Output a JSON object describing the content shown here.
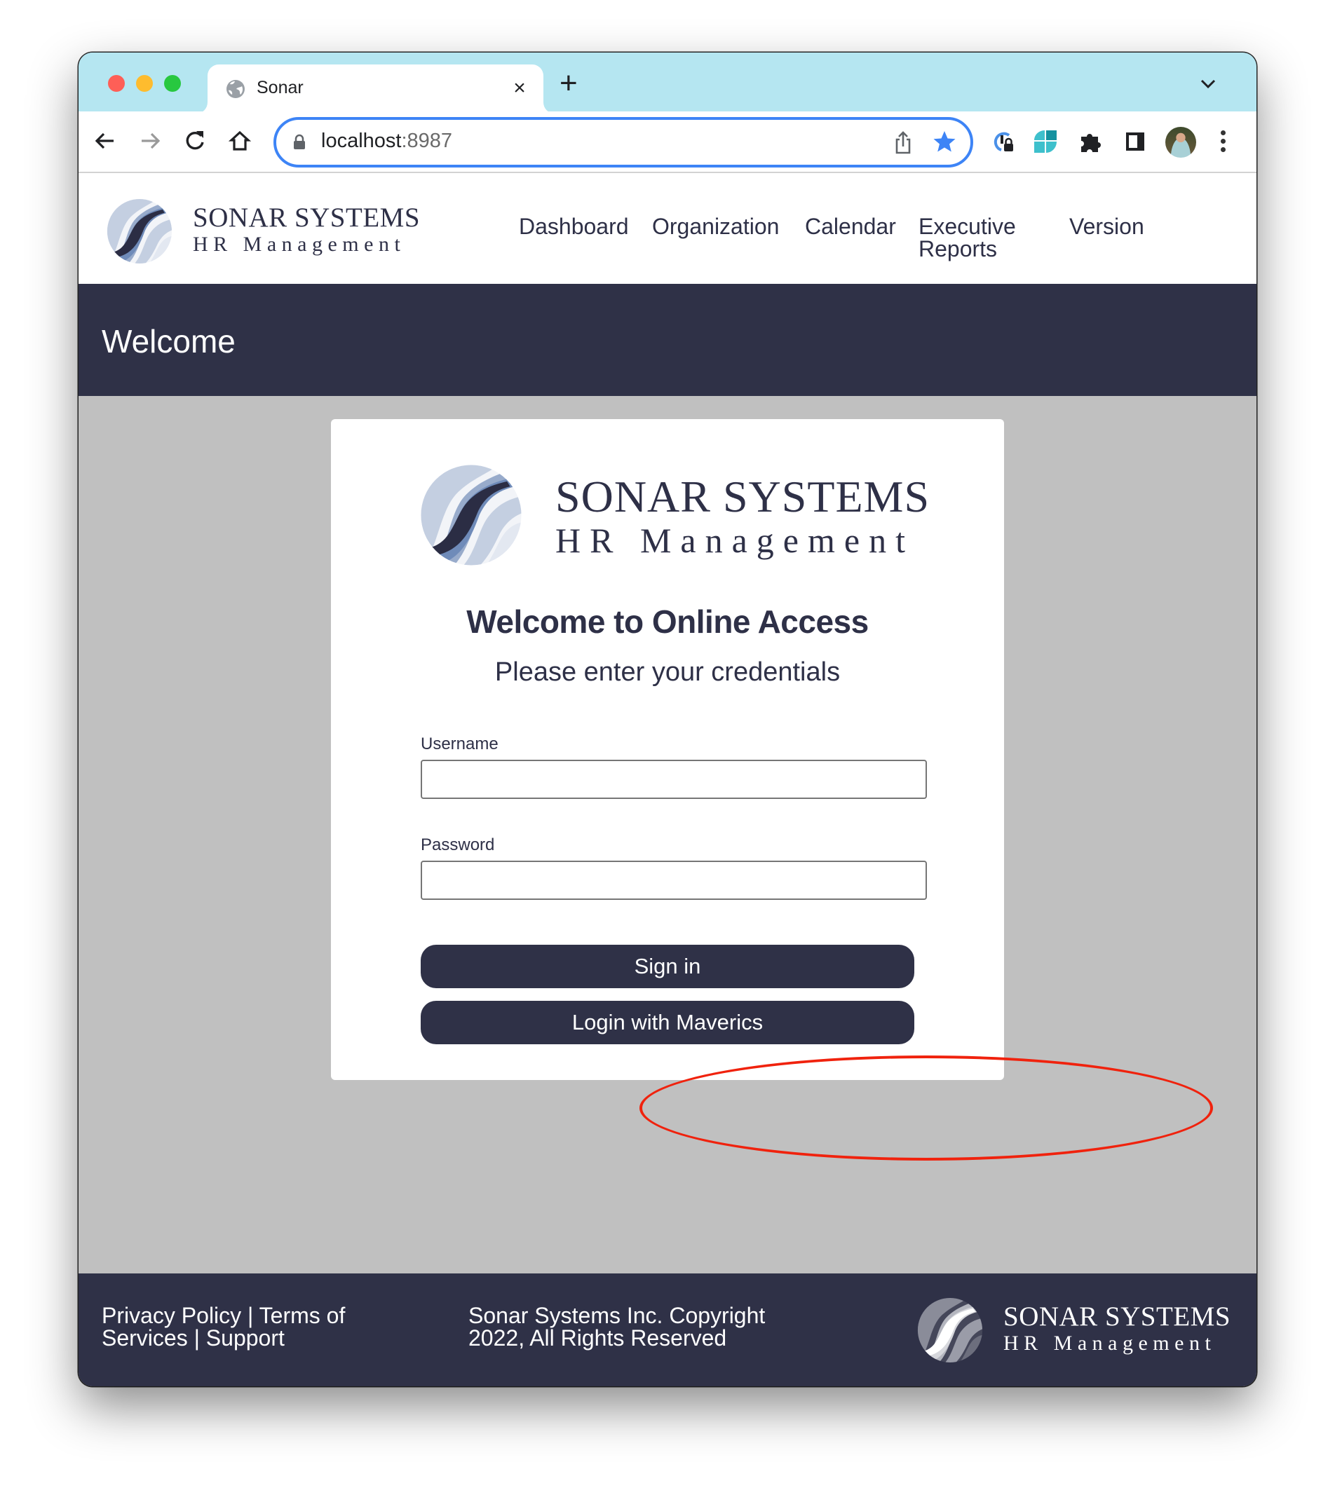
{
  "browser": {
    "tab": {
      "title": "Sonar",
      "favicon": "globe-icon",
      "close_glyph": "×"
    },
    "new_tab_glyph": "+",
    "address": {
      "host": "localhost",
      "port": ":8987"
    },
    "toolbar_icons": [
      "back-arrow-icon",
      "forward-arrow-icon",
      "reload-icon",
      "home-icon",
      "lock-icon",
      "share-icon",
      "bookmark-star-icon",
      "extension-password-icon",
      "extension-tiles-icon",
      "extensions-puzzle-icon",
      "side-panel-icon",
      "profile-avatar",
      "menu-dots-icon"
    ],
    "colors": {
      "tabstrip": "#b5e6f1",
      "omnibox_border": "#3d84f6",
      "star": "#3d84f6"
    }
  },
  "header": {
    "brand_line1": "SONAR SYSTEMS",
    "brand_line2": "HR Management",
    "nav": [
      {
        "label": "Dashboard"
      },
      {
        "label": "Organization"
      },
      {
        "label": "Calendar"
      },
      {
        "label": "Executive Reports"
      },
      {
        "label": "Version"
      }
    ]
  },
  "banner": {
    "title": "Welcome"
  },
  "login": {
    "brand_line1": "SONAR SYSTEMS",
    "brand_line2": "HR Management",
    "title": "Welcome to Online Access",
    "subtitle": "Please enter your credentials",
    "username_label": "Username",
    "username_value": "",
    "password_label": "Password",
    "password_value": "",
    "sign_in_label": "Sign in",
    "maverics_label": "Login with Maverics"
  },
  "annotation": {
    "target": "Login with Maverics",
    "color": "#f0220d"
  },
  "footer": {
    "privacy": "Privacy Policy",
    "separator": " | ",
    "terms": "Terms of Services",
    "support": "Support",
    "copyright": "Sonar Systems Inc. Copyright 2022, All Rights Reserved",
    "brand_line1": "SONAR SYSTEMS",
    "brand_line2": "HR Management"
  },
  "theme": {
    "primary": "#2f3147",
    "page_bg": "#c0c0c0",
    "card_bg": "#ffffff"
  }
}
